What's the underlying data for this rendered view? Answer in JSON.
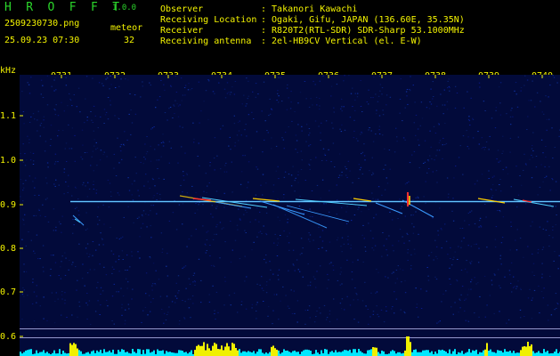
{
  "header": {
    "title": "H R O F F T",
    "version": "1.0.0",
    "filename": "2509230730.png",
    "datetime": "25.09.23 07:30",
    "meteor_label": "meteor",
    "meteor_count": "32",
    "info": [
      {
        "label": "Observer",
        "value": ": Takanori Kawachi"
      },
      {
        "label": "Receiving Location",
        "value": ": Ogaki, Gifu, JAPAN (136.60E, 35.35N)"
      },
      {
        "label": "Receiver",
        "value": ": R820T2(RTL-SDR) SDR-Sharp 53.1000MHz"
      },
      {
        "label": "Receiving antenna",
        "value": ": 2el-HB9CV Vertical (el. E-W)"
      }
    ]
  },
  "spectrogram": {
    "y_unit": "kHz",
    "y_ticks": [
      "1.1",
      "1.0",
      "0.9",
      "0.8",
      "0.7",
      "0.6"
    ],
    "x_ticks": [
      "0731",
      "0732",
      "0733",
      "0734",
      "0735",
      "0736",
      "0737",
      "0738",
      "0739",
      "0740"
    ],
    "carrier_khz": 0.905,
    "colors": {
      "text_yellow": "#f4f400",
      "text_green": "#2bd62b",
      "noise_bar": "#00e8ff"
    }
  }
}
